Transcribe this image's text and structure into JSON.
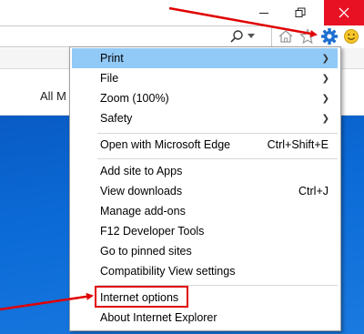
{
  "window": {
    "controls": {
      "minimize": "minimize",
      "restore": "restore",
      "close": "close"
    }
  },
  "toolbar": {
    "icons": [
      "search-icon",
      "dropdown-arrow-icon",
      "home-icon",
      "favorites-star-icon",
      "gear-icon",
      "smiley-feedback-icon"
    ]
  },
  "page": {
    "nav_text": "All M"
  },
  "menu": {
    "groups": [
      [
        {
          "label": "Print",
          "submenu": true,
          "highlighted": true
        },
        {
          "label": "File",
          "submenu": true
        },
        {
          "label": "Zoom (100%)",
          "submenu": true
        },
        {
          "label": "Safety",
          "submenu": true
        }
      ],
      [
        {
          "label": "Open with Microsoft Edge",
          "shortcut": "Ctrl+Shift+E"
        }
      ],
      [
        {
          "label": "Add site to Apps"
        },
        {
          "label": "View downloads",
          "shortcut": "Ctrl+J"
        },
        {
          "label": "Manage add-ons"
        },
        {
          "label": "F12 Developer Tools"
        },
        {
          "label": "Go to pinned sites"
        },
        {
          "label": "Compatibility View settings"
        }
      ],
      [
        {
          "label": "Internet options",
          "outlined": true
        },
        {
          "label": "About Internet Explorer"
        }
      ]
    ]
  },
  "colors": {
    "close_button": "#e81123",
    "menu_highlight": "#91c9f7",
    "annotation_red": "#e00000",
    "gear_blue": "#1f6fd1",
    "hero_blue": "#0b6ad6"
  }
}
